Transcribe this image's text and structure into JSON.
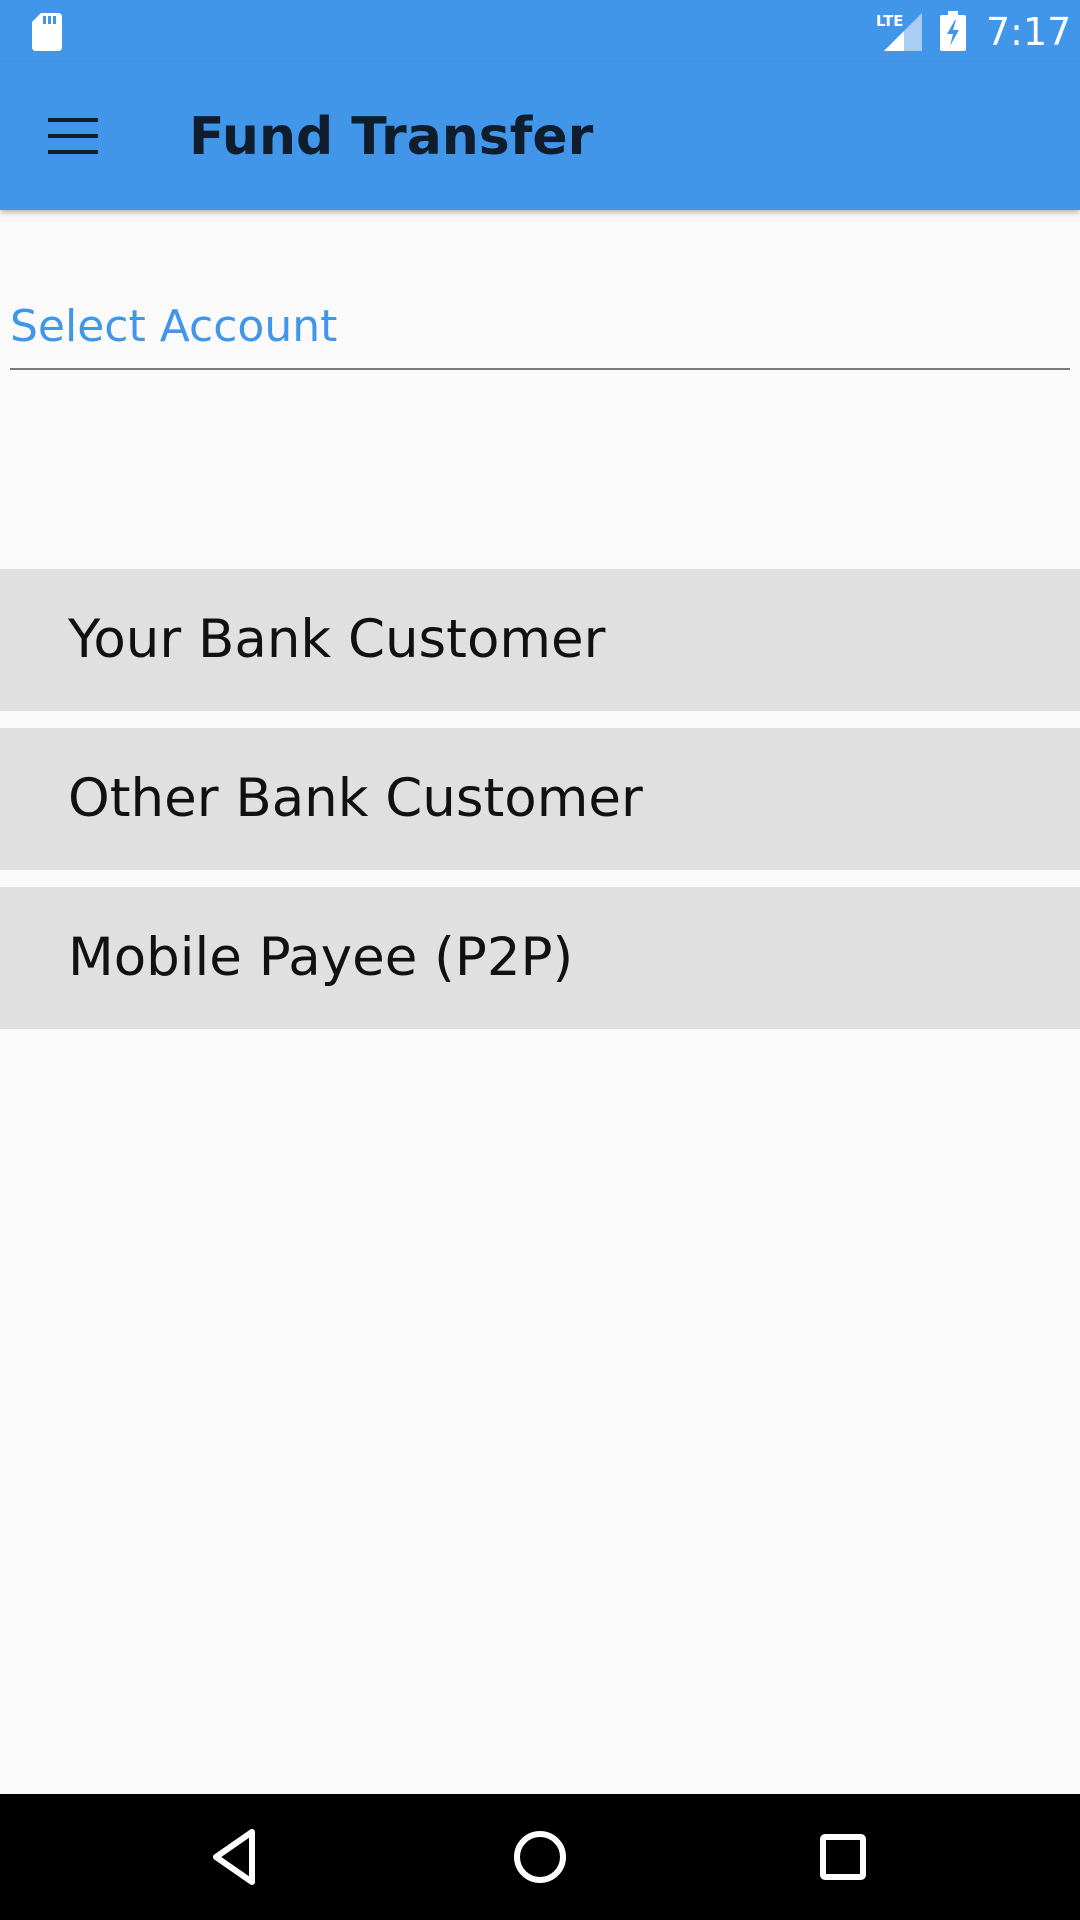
{
  "status_bar": {
    "time": "7:17",
    "network_label": "LTE",
    "icons": [
      "sd-card-icon",
      "lte-signal-icon",
      "battery-charging-icon"
    ]
  },
  "app_bar": {
    "title": "Fund Transfer",
    "menu_icon": "hamburger-menu-icon"
  },
  "form": {
    "select_account_label": "Select Account"
  },
  "options": [
    {
      "label": "Your Bank Customer"
    },
    {
      "label": "Other Bank Customer"
    },
    {
      "label": "Mobile Payee (P2P)"
    }
  ],
  "nav_bar": {
    "icons": [
      "back-icon",
      "home-icon",
      "recents-icon"
    ]
  },
  "colors": {
    "primary": "#4196e9",
    "title_text": "#0f1d2c",
    "option_background": "#e0e0e0",
    "page_background": "#fafafa",
    "nav_background": "#000000"
  }
}
